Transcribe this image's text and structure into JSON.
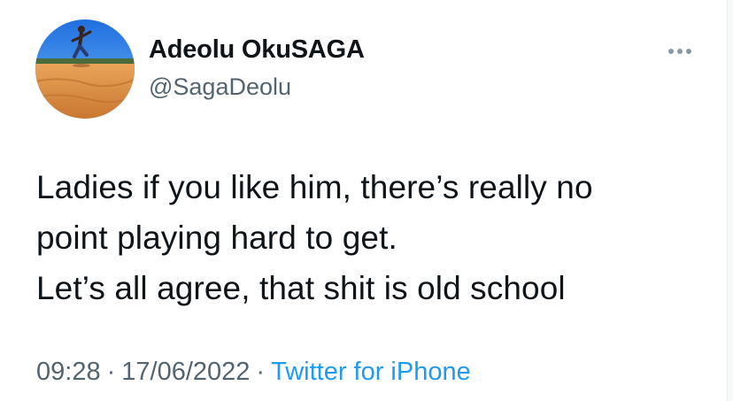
{
  "author": {
    "display_name": "Adeolu OkuSAGA",
    "handle": "@SagaDeolu",
    "avatar_icon": "profile-photo-beach"
  },
  "tweet": {
    "lines": [
      "Ladies if you like him, there’s really no",
      "point playing hard to get.",
      "Let’s all agree, that shit is old school"
    ]
  },
  "meta": {
    "time": "09:28",
    "separator": "·",
    "date": "17/06/2022",
    "source": "Twitter for iPhone"
  },
  "more_menu_icon": "more-dots-icon",
  "colors": {
    "text": "#0f1419",
    "secondary": "#536471",
    "link": "#1d9bf0"
  }
}
